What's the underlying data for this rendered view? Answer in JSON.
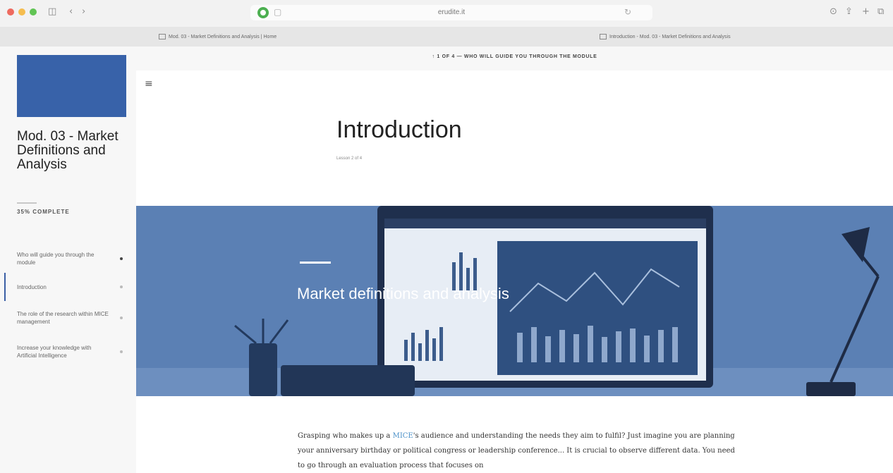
{
  "browser": {
    "url": "erudite.it",
    "tabs": [
      "Mod. 03 - Market Definitions and Analysis | Home",
      "Introduction - Mod. 03 - Market Definitions and Analysis"
    ],
    "icons": [
      "sidebar-toggle-icon",
      "back-icon",
      "forward-icon",
      "shield-icon",
      "page-icon",
      "reload-icon",
      "download-icon",
      "share-icon",
      "new-tab-icon",
      "tab-overview-icon"
    ]
  },
  "sidebar": {
    "course_title": "Mod. 03 - Market Definitions and Analysis",
    "progress": {
      "label": "35% COMPLETE",
      "percent": 35
    },
    "lessons": [
      {
        "label": "Who will guide you through the module",
        "status": "done"
      },
      {
        "label": "Introduction",
        "status": "current"
      },
      {
        "label": "The role of the research within MICE management",
        "status": "todo"
      },
      {
        "label": "Increase your knowledge with Artificial Intelligence",
        "status": "todo"
      }
    ]
  },
  "main": {
    "top_nav": "1 OF 4 — WHO WILL GUIDE YOU THROUGH THE MODULE",
    "title": "Introduction",
    "lesson_count": "Lesson 2 of 4",
    "hero_title": "Market definitions and analysis",
    "body": {
      "before_link": "Grasping who makes up a ",
      "link": "MICE",
      "after_link": "'s audience and understanding the needs they aim to fulfil? Just imagine you are planning your anniversary birthday or political congress or leadership conference... It is crucial to observe different data. You need to go through an evaluation process that focuses on"
    }
  },
  "colors": {
    "brand_blue": "#3862a9",
    "hero_tint": "#5b80b4",
    "link": "#4a90c8"
  }
}
